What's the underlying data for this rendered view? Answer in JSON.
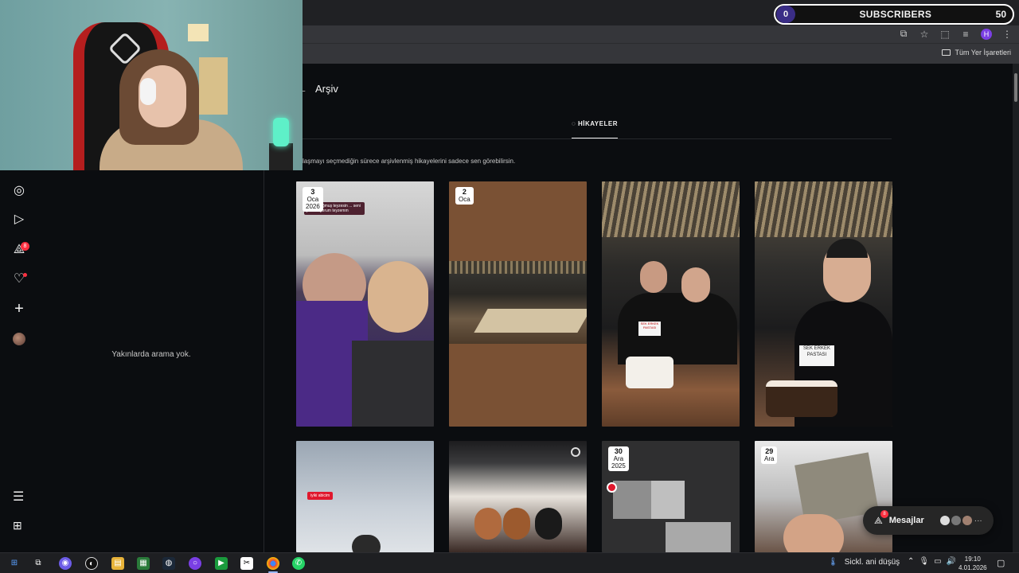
{
  "browser": {
    "bookmarks_label": "Tüm Yer İşaretleri",
    "profile_initial": "H"
  },
  "overlay": {
    "subscribers_label": "SUBSCRIBERS",
    "left_count": "0",
    "right_count": "50"
  },
  "search_panel": {
    "empty_text": "Yakınlarda arama yok."
  },
  "nav": {
    "notification_badge": "8"
  },
  "archive": {
    "title": "Arşiv",
    "tab_label": "HİKAYELER",
    "info_text": "ylaşmayı seçmediğin sürece arşivlenmiş hikayelerini sadece sen görebilirsin.",
    "stories": [
      {
        "day": "3",
        "month": "Oca",
        "year": "2026",
        "caption": "m iyiki doğmuş teyzesin ... seni çok seviyorum teyzemm"
      },
      {
        "day": "2",
        "month": "Oca",
        "year": ""
      },
      {
        "day": "",
        "month": "",
        "year": "",
        "sign": "SEK ERKEK PASTASI"
      },
      {
        "day": "",
        "month": "",
        "year": "",
        "sign": "SEK ERKEK PASTASI"
      },
      {
        "day": "",
        "month": "",
        "year": "",
        "caption": "iyiki abicim"
      },
      {
        "day": "",
        "month": "",
        "year": ""
      },
      {
        "day": "30",
        "month": "Ara",
        "year": "2025"
      },
      {
        "day": "29",
        "month": "Ara",
        "year": ""
      }
    ]
  },
  "messages": {
    "label": "Mesajlar",
    "badge": "8"
  },
  "taskbar": {
    "weather": "Sickl. ani düşüş",
    "time": "19:10",
    "date": "4.01.2026"
  },
  "colors": {
    "background": "#0b0d10",
    "badge_red": "#ff3040",
    "chrome": "#35363a"
  }
}
